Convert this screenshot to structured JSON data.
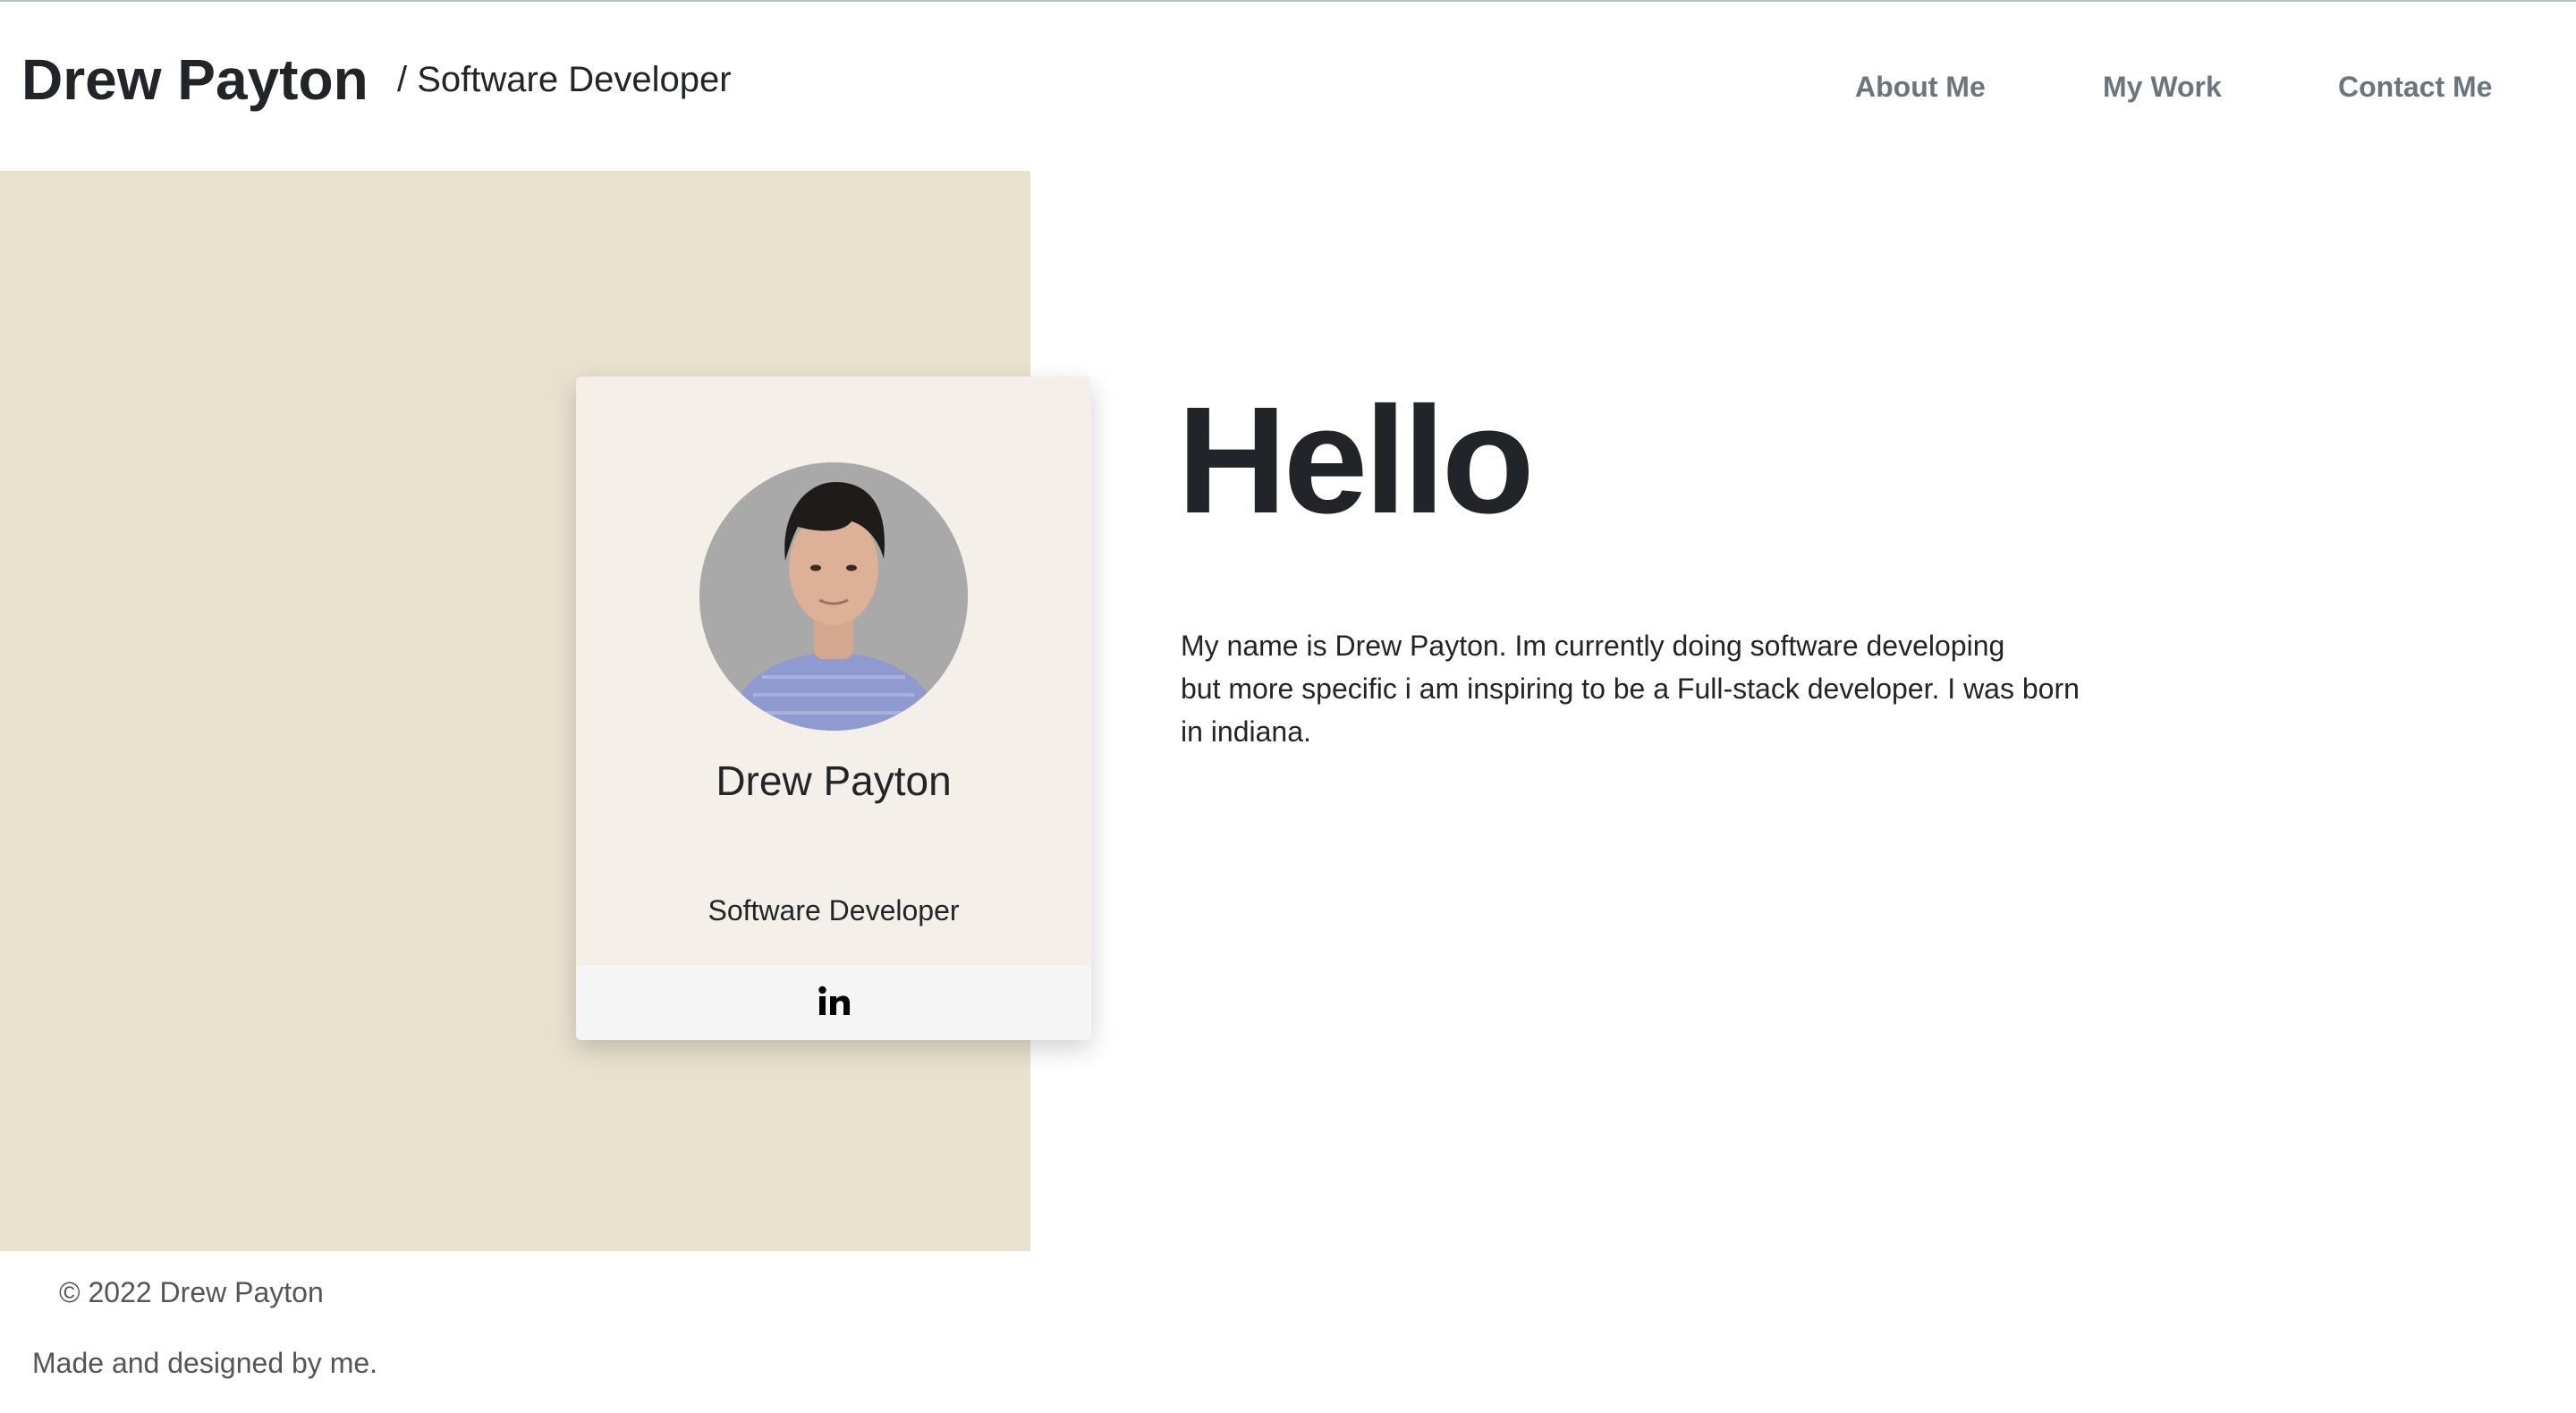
{
  "header": {
    "title": "Drew Payton",
    "subtitle": "/ Software Developer"
  },
  "nav": {
    "about": "About Me",
    "work": "My Work",
    "contact": "Contact Me"
  },
  "profile_card": {
    "name": "Drew Payton",
    "role": "Software Developer",
    "social_icon": "linkedin-icon"
  },
  "intro": {
    "heading": "Hello",
    "bio_lines": [
      "My name is Drew Payton. Im currently doing software developing",
      "but more specific i am inspiring to be a Full-stack developer. I was born",
      "in indiana."
    ]
  },
  "footer": {
    "copyright": "© 2022 Drew Payton",
    "tagline": "Made and designed by me."
  },
  "colors": {
    "panel": "#e9e1ce",
    "card": "#f4f0e9",
    "nav_text": "#6c757d",
    "heading": "#212529"
  }
}
